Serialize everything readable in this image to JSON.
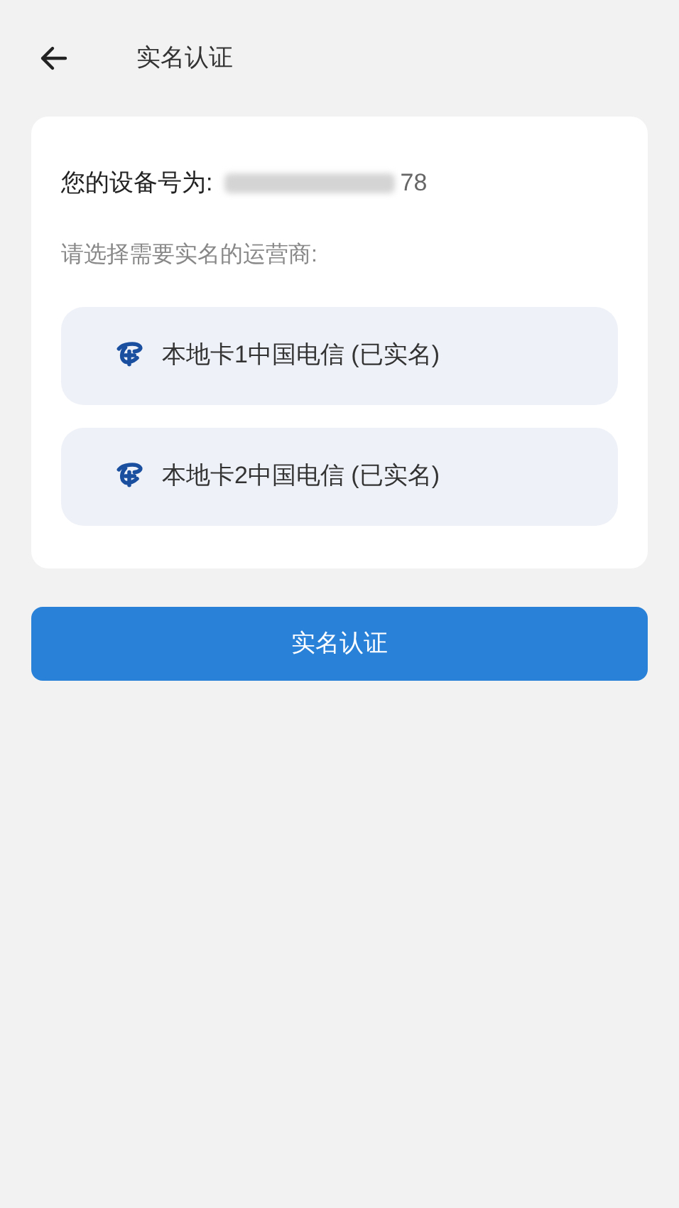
{
  "header": {
    "title": "实名认证"
  },
  "device": {
    "label": "您的设备号为:",
    "value_tail": "78"
  },
  "prompt": "请选择需要实名的运营商:",
  "carriers": [
    {
      "label": "本地卡1中国电信 (已实名)"
    },
    {
      "label": "本地卡2中国电信 (已实名)"
    }
  ],
  "submit_button": "实名认证"
}
